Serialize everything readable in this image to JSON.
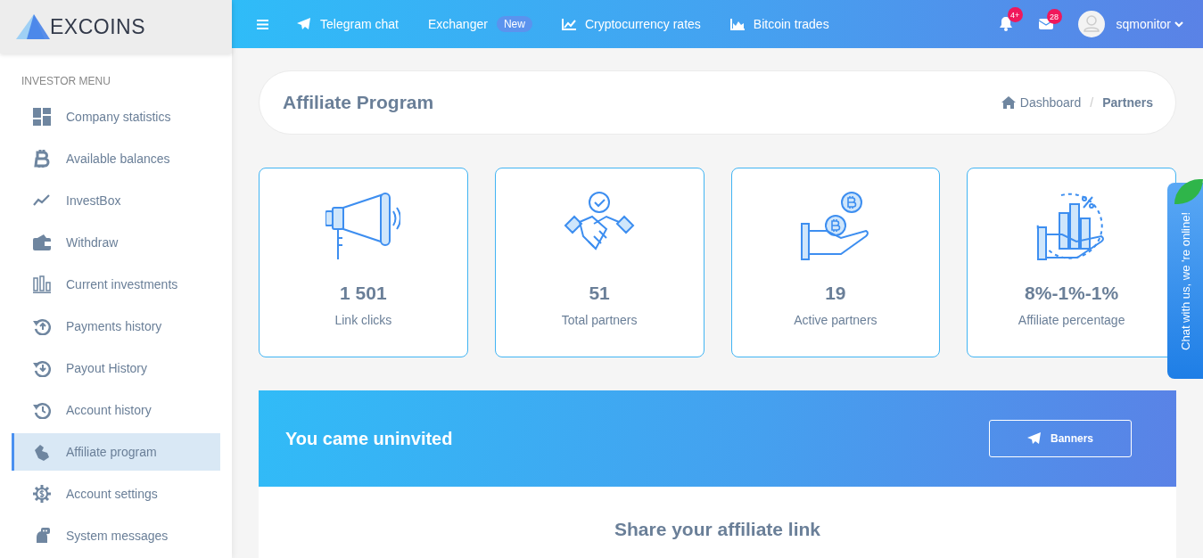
{
  "logo": {
    "text": "EXCOINS"
  },
  "topbar": {
    "links": [
      {
        "label": "Telegram chat"
      },
      {
        "label": "Exchanger",
        "badge": "New"
      },
      {
        "label": "Cryptocurrency rates"
      },
      {
        "label": "Bitcoin trades"
      }
    ],
    "notifications": "4+",
    "messages": "28",
    "user": "sqmonitor"
  },
  "sidebar": {
    "heading": "INVESTOR MENU",
    "items": [
      {
        "label": "Company statistics",
        "selected": false
      },
      {
        "label": "Available balances",
        "selected": false
      },
      {
        "label": "InvestBox",
        "selected": false
      },
      {
        "label": "Withdraw",
        "selected": false
      },
      {
        "label": "Current investments",
        "selected": false
      },
      {
        "label": "Payments history",
        "selected": false
      },
      {
        "label": "Payout History",
        "selected": false
      },
      {
        "label": "Account history",
        "selected": false
      },
      {
        "label": "Affiliate program",
        "selected": true
      },
      {
        "label": "Account settings",
        "selected": false
      },
      {
        "label": "System messages",
        "selected": false
      }
    ]
  },
  "page": {
    "title": "Affiliate Program",
    "breadcrumb": [
      {
        "label": "Dashboard",
        "current": false
      },
      {
        "label": "Partners",
        "current": true
      }
    ],
    "separator": "/"
  },
  "stats": [
    {
      "value": "1 501",
      "label": "Link clicks"
    },
    {
      "value": "51",
      "label": "Total partners"
    },
    {
      "value": "19",
      "label": "Active partners"
    },
    {
      "value": "8%-1%-1%",
      "label": "Affiliate percentage"
    }
  ],
  "banner": {
    "title": "You came uninvited",
    "button": "Banners"
  },
  "share": {
    "title": "Share your affiliate link"
  },
  "chat": {
    "label": "Chat with us, we 're online!"
  }
}
